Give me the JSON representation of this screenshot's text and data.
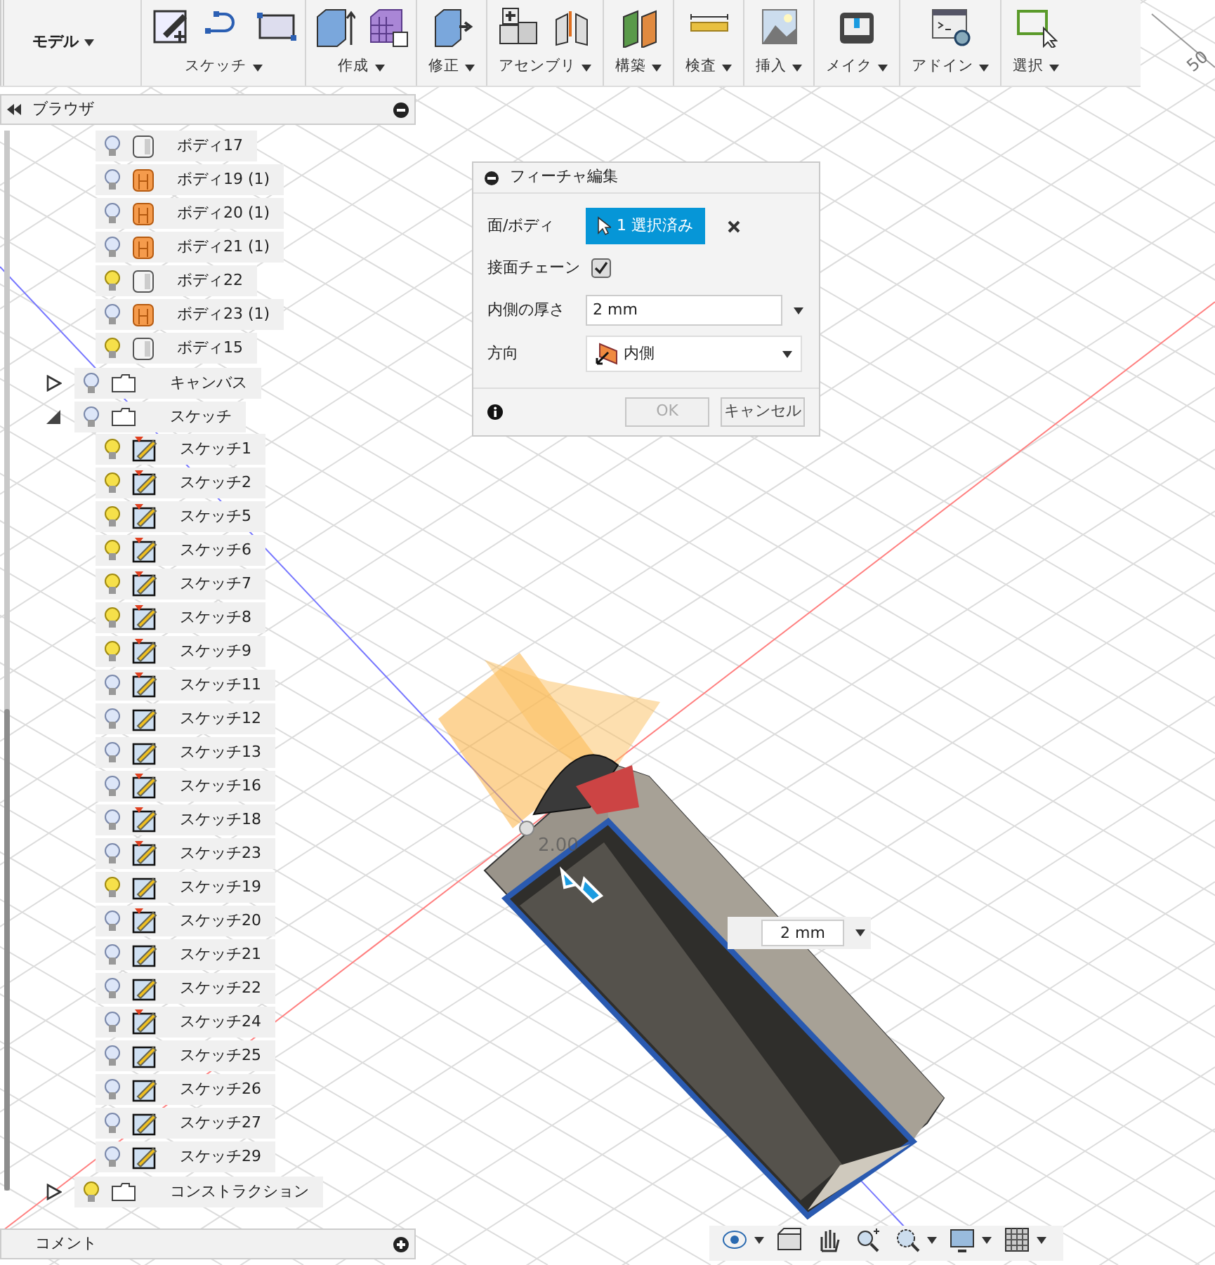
{
  "toolbar": {
    "workspace": "モデル",
    "groups": [
      {
        "label": "スケッチ"
      },
      {
        "label": "作成"
      },
      {
        "label": "修正"
      },
      {
        "label": "アセンブリ"
      },
      {
        "label": "構築"
      },
      {
        "label": "検査"
      },
      {
        "label": "挿入"
      },
      {
        "label": "メイク"
      },
      {
        "label": "アドイン"
      },
      {
        "label": "選択"
      }
    ]
  },
  "browser": {
    "title": "ブラウザ",
    "bodies": [
      {
        "label": "ボディ17",
        "kind": "body",
        "visible": false
      },
      {
        "label": "ボディ19 (1)",
        "kind": "component",
        "visible": false
      },
      {
        "label": "ボディ20 (1)",
        "kind": "component",
        "visible": false
      },
      {
        "label": "ボディ21 (1)",
        "kind": "component",
        "visible": false
      },
      {
        "label": "ボディ22",
        "kind": "body",
        "visible": true
      },
      {
        "label": "ボディ23 (1)",
        "kind": "component",
        "visible": false
      },
      {
        "label": "ボディ15",
        "kind": "body",
        "visible": true
      }
    ],
    "folders": [
      {
        "label": "キャンバス",
        "visible": false,
        "expanded": false
      },
      {
        "label": "スケッチ",
        "visible": false,
        "expanded": true,
        "children": [
          {
            "label": "スケッチ1",
            "visible": true,
            "flagged": true
          },
          {
            "label": "スケッチ2",
            "visible": true,
            "flagged": true
          },
          {
            "label": "スケッチ5",
            "visible": true,
            "flagged": true
          },
          {
            "label": "スケッチ6",
            "visible": true,
            "flagged": true
          },
          {
            "label": "スケッチ7",
            "visible": true,
            "flagged": true
          },
          {
            "label": "スケッチ8",
            "visible": true,
            "flagged": true
          },
          {
            "label": "スケッチ9",
            "visible": true,
            "flagged": true
          },
          {
            "label": "スケッチ11",
            "visible": false,
            "flagged": true
          },
          {
            "label": "スケッチ12",
            "visible": false,
            "flagged": false
          },
          {
            "label": "スケッチ13",
            "visible": false,
            "flagged": false
          },
          {
            "label": "スケッチ16",
            "visible": false,
            "flagged": true
          },
          {
            "label": "スケッチ18",
            "visible": false,
            "flagged": true
          },
          {
            "label": "スケッチ23",
            "visible": false,
            "flagged": true
          },
          {
            "label": "スケッチ19",
            "visible": true,
            "flagged": false
          },
          {
            "label": "スケッチ20",
            "visible": false,
            "flagged": true
          },
          {
            "label": "スケッチ21",
            "visible": false,
            "flagged": false
          },
          {
            "label": "スケッチ22",
            "visible": false,
            "flagged": false
          },
          {
            "label": "スケッチ24",
            "visible": false,
            "flagged": true
          },
          {
            "label": "スケッチ25",
            "visible": false,
            "flagged": false
          },
          {
            "label": "スケッチ26",
            "visible": false,
            "flagged": false
          },
          {
            "label": "スケッチ27",
            "visible": false,
            "flagged": false
          },
          {
            "label": "スケッチ29",
            "visible": false,
            "flagged": false
          }
        ]
      },
      {
        "label": "コンストラクション",
        "visible": true,
        "expanded": false
      }
    ]
  },
  "dialog": {
    "title": "フィーチャ編集",
    "rows": [
      {
        "kind": "selection",
        "label": "面/ボディ",
        "value": "1 選択済み"
      },
      {
        "kind": "checkbox",
        "label": "接面チェーン",
        "checked": true
      },
      {
        "kind": "input",
        "label": "内側の厚さ",
        "value": "2 mm"
      },
      {
        "kind": "dropdown",
        "label": "方向",
        "value": "内側"
      }
    ],
    "buttons": [
      {
        "label": "OK",
        "disabled": true
      },
      {
        "label": "キャンセル",
        "disabled": false
      }
    ]
  },
  "viewport": {
    "dimension_input": "2 mm",
    "dimension_label": "2.00",
    "ruler_label": "50"
  },
  "comments": {
    "title": "コメント"
  }
}
